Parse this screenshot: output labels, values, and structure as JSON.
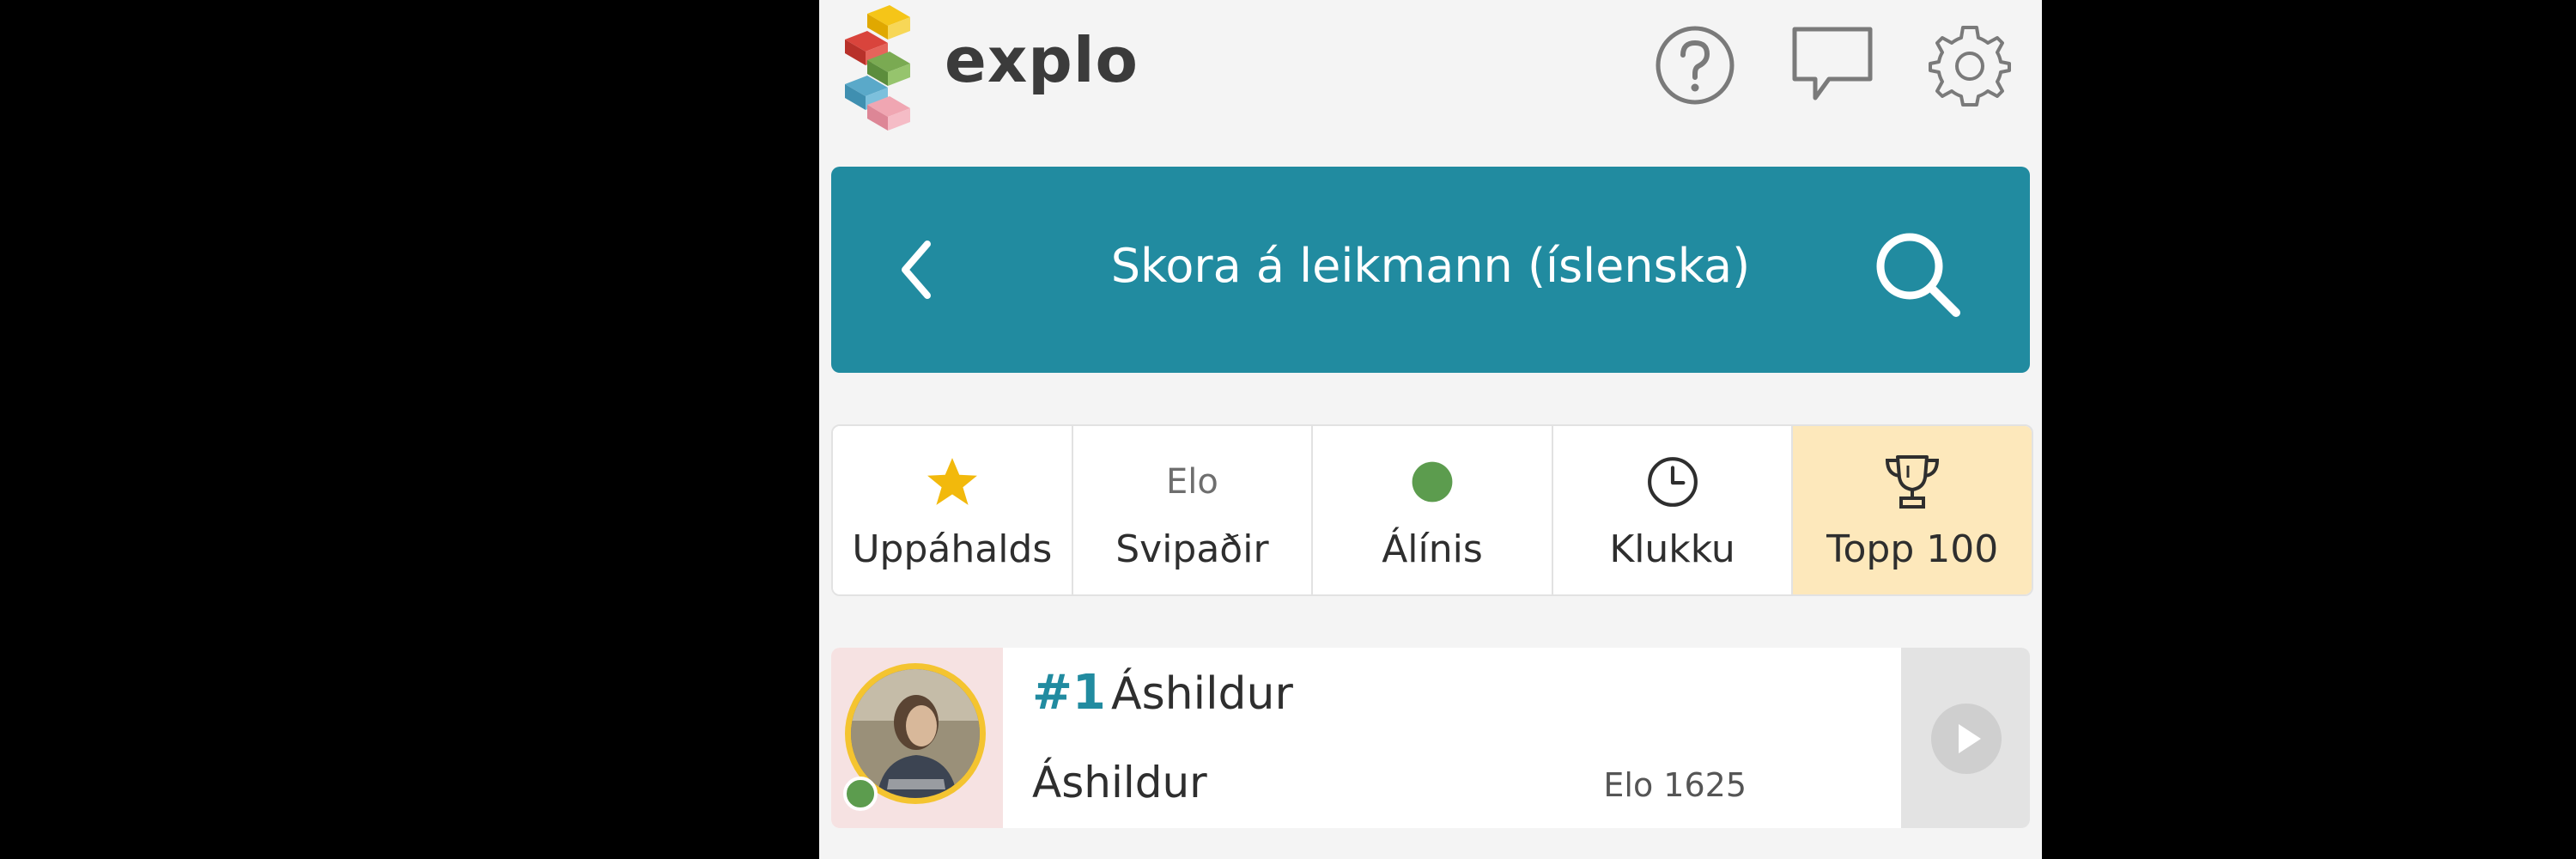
{
  "app": {
    "brand": "explo",
    "colors": {
      "teal": "#218ba0",
      "gold": "#f4c430",
      "online": "#5c9c4e",
      "active_tab": "#fde8bb"
    }
  },
  "toolbar": {
    "icons": [
      "help-icon",
      "chat-icon",
      "settings-icon"
    ]
  },
  "header": {
    "title": "Skora á leikmann (íslenska)",
    "back_icon": "chevron-left-icon",
    "search_icon": "search-icon"
  },
  "tabs": [
    {
      "label": "Uppáhalds",
      "icon": "star-icon"
    },
    {
      "label": "Svipaðir",
      "icon_text": "Elo"
    },
    {
      "label": "Álínis",
      "icon": "online-dot-icon"
    },
    {
      "label": "Klukku",
      "icon": "clock-icon"
    },
    {
      "label": "Topp 100",
      "icon": "trophy-icon",
      "active": true
    }
  ],
  "players": [
    {
      "rank": "#1",
      "name": "Áshildur",
      "fullname": "Áshildur",
      "elo": "Elo 1625",
      "online": true
    }
  ]
}
